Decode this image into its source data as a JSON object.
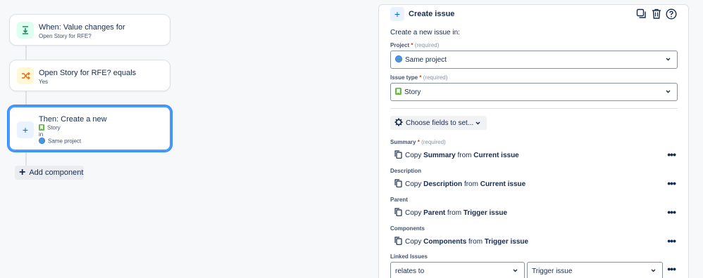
{
  "rule": {
    "trigger": {
      "title": "When: Value changes for",
      "subtitle": "Open Story for RFE?"
    },
    "condition": {
      "title": "Open Story for RFE? equals",
      "subtitle": "Yes"
    },
    "action": {
      "title": "Then: Create a new",
      "issue_type": "Story",
      "in_label": "in",
      "project": "Same project"
    },
    "add_component_label": "Add component"
  },
  "panel": {
    "title": "Create issue",
    "intro": "Create a new issue in:",
    "project": {
      "label": "Project",
      "required": "(required)",
      "value": "Same project"
    },
    "issue_type": {
      "label": "Issue type",
      "required": "(required)",
      "value": "Story"
    },
    "choose_fields_label": "Choose fields to set...",
    "fields": [
      {
        "label": "Summary",
        "required": "(required)",
        "copy": "Copy",
        "field": "Summary",
        "from": "from",
        "source": "Current issue"
      },
      {
        "label": "Description",
        "copy": "Copy",
        "field": "Description",
        "from": "from",
        "source": "Current issue"
      },
      {
        "label": "Parent",
        "copy": "Copy",
        "field": "Parent",
        "from": "from",
        "source": "Trigger issue"
      },
      {
        "label": "Components",
        "copy": "Copy",
        "field": "Components",
        "from": "from",
        "source": "Trigger issue"
      }
    ],
    "linked_issues": {
      "label": "Linked Issues",
      "relation": "relates to",
      "target": "Trigger issue"
    },
    "more_symbol": "•••"
  },
  "colors": {
    "accent": "#0c66e4",
    "selected_border": "#4c9aff",
    "required": "#de350b",
    "story_green": "#63ba3c"
  }
}
